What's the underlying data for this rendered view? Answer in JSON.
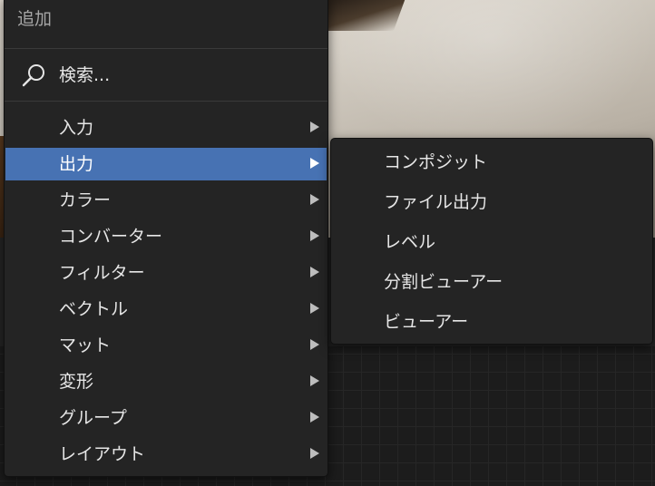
{
  "menu": {
    "title": "追加",
    "search_label": "検索...",
    "items": [
      {
        "label": "入力"
      },
      {
        "label": "出力"
      },
      {
        "label": "カラー"
      },
      {
        "label": "コンバーター"
      },
      {
        "label": "フィルター"
      },
      {
        "label": "ベクトル"
      },
      {
        "label": "マット"
      },
      {
        "label": "変形"
      },
      {
        "label": "グループ"
      },
      {
        "label": "レイアウト"
      }
    ],
    "active_item": "出力"
  },
  "submenu": {
    "items": [
      {
        "label": "コンポジット"
      },
      {
        "label": "ファイル出力"
      },
      {
        "label": "レベル"
      },
      {
        "label": "分割ビューアー"
      },
      {
        "label": "ビューアー"
      }
    ]
  },
  "colors": {
    "highlight": "#4772b3",
    "menu_background": "#242424",
    "text": "#e6e6e6"
  },
  "icons": {
    "search": "search-icon",
    "submenu_arrow": "triangle-right-icon"
  }
}
